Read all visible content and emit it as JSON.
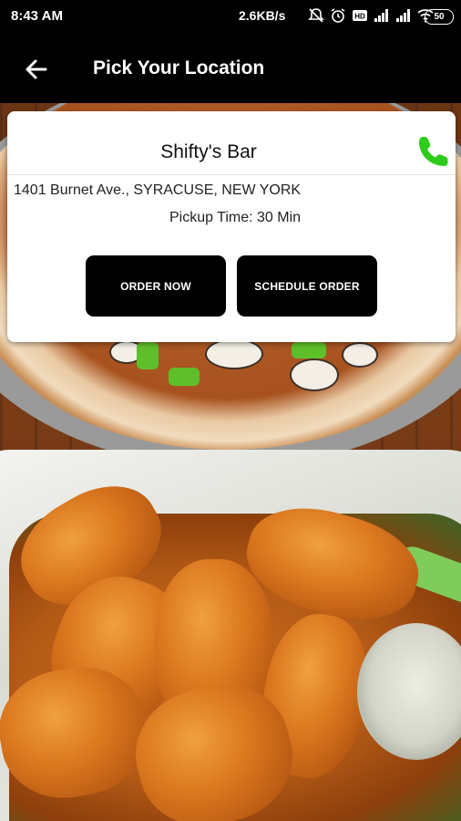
{
  "status_bar": {
    "time": "8:43 AM",
    "network_speed": "2.6KB/s",
    "battery": "50",
    "icons": [
      "mute-icon",
      "alarm-icon",
      "hd-icon",
      "signal-icon",
      "signal-icon",
      "wifi-icon",
      "battery-icon"
    ]
  },
  "app_bar": {
    "title": "Pick Your Location",
    "back_icon": "back-arrow-icon"
  },
  "location_card": {
    "name": "Shifty's Bar",
    "address": "1401 Burnet Ave., SYRACUSE, NEW YORK",
    "pickup_time": "Pickup Time: 30 Min",
    "phone_icon": "phone-icon",
    "phone_color": "#2ecc1a",
    "order_now_label": "ORDER NOW",
    "schedule_order_label": "SCHEDULE ORDER"
  },
  "colors": {
    "app_bar": "#000000",
    "button": "#000000",
    "card": "#ffffff"
  }
}
